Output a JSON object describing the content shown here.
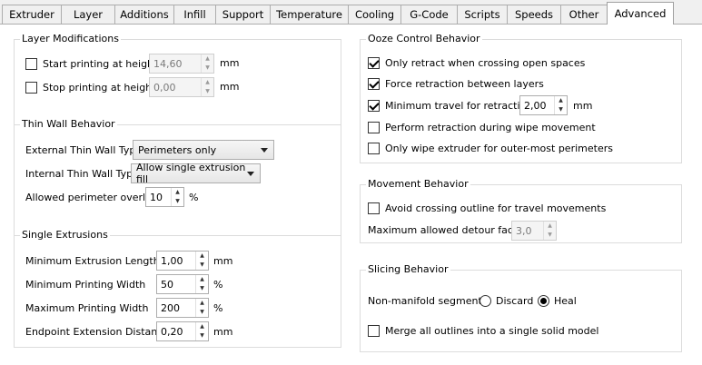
{
  "tabs": [
    {
      "label": "Extruder"
    },
    {
      "label": "Layer"
    },
    {
      "label": "Additions"
    },
    {
      "label": "Infill"
    },
    {
      "label": "Support"
    },
    {
      "label": "Temperature"
    },
    {
      "label": "Cooling"
    },
    {
      "label": "G-Code"
    },
    {
      "label": "Scripts"
    },
    {
      "label": "Speeds"
    },
    {
      "label": "Other"
    },
    {
      "label": "Advanced",
      "active": true
    }
  ],
  "layer_modifications": {
    "title": "Layer Modifications",
    "start": {
      "label": "Start printing at height",
      "checked": false,
      "value": "14,60",
      "unit": "mm"
    },
    "stop": {
      "label": "Stop printing at height",
      "checked": false,
      "value": "0,00",
      "unit": "mm"
    }
  },
  "thin_wall": {
    "title": "Thin Wall Behavior",
    "external": {
      "label": "External Thin Wall Type",
      "value": "Perimeters only"
    },
    "internal": {
      "label": "Internal Thin Wall Type",
      "value": "Allow single extrusion fill"
    },
    "overlap": {
      "label": "Allowed perimeter overlap",
      "value": "10",
      "unit": "%"
    }
  },
  "single_extrusions": {
    "title": "Single Extrusions",
    "min_length": {
      "label": "Minimum Extrusion Length",
      "value": "1,00",
      "unit": "mm"
    },
    "min_width": {
      "label": "Minimum Printing Width",
      "value": "50",
      "unit": "%"
    },
    "max_width": {
      "label": "Maximum Printing Width",
      "value": "200",
      "unit": "%"
    },
    "endpoint": {
      "label": "Endpoint Extension Distance",
      "value": "0,20",
      "unit": "mm"
    }
  },
  "ooze": {
    "title": "Ooze Control Behavior",
    "only_retract": {
      "label": "Only retract when crossing open spaces",
      "checked": true
    },
    "force_retract": {
      "label": "Force retraction between layers",
      "checked": true
    },
    "min_travel": {
      "label": "Minimum travel for retraction",
      "checked": true,
      "value": "2,00",
      "unit": "mm"
    },
    "wipe_retract": {
      "label": "Perform retraction during wipe movement",
      "checked": false
    },
    "only_wipe": {
      "label": "Only wipe extruder for outer-most perimeters",
      "checked": false
    }
  },
  "movement": {
    "title": "Movement Behavior",
    "avoid": {
      "label": "Avoid crossing outline for travel movements",
      "checked": false
    },
    "detour": {
      "label": "Maximum allowed detour factor",
      "value": "3,0"
    }
  },
  "slicing": {
    "title": "Slicing Behavior",
    "non_manifold": {
      "label": "Non-manifold segments:",
      "discard": "Discard",
      "heal": "Heal",
      "selected": "heal"
    },
    "merge": {
      "label": "Merge all outlines into a single solid model",
      "checked": false
    }
  }
}
